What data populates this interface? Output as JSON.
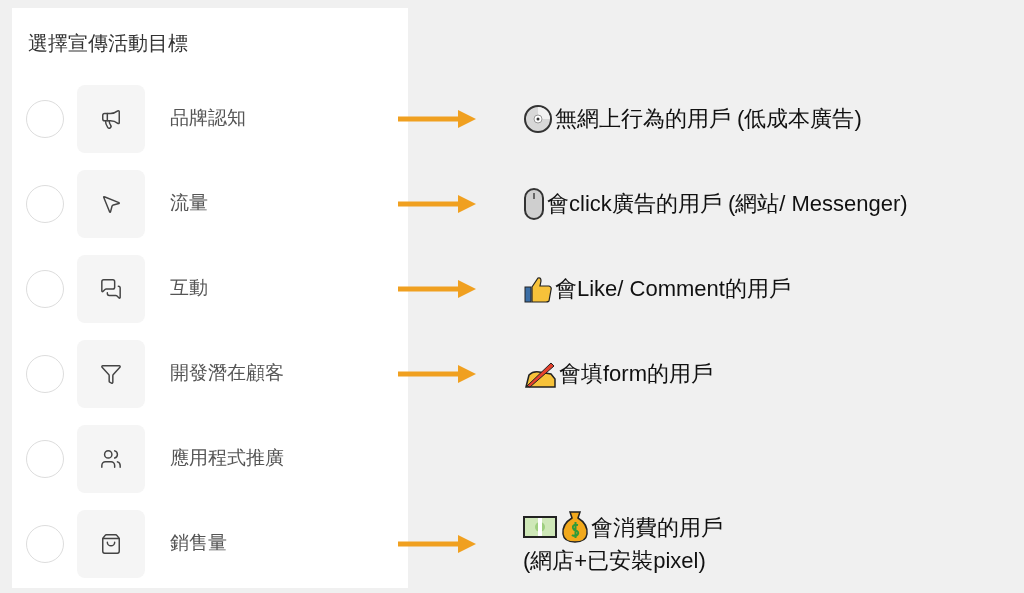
{
  "title": "選擇宣傳活動目標",
  "objectives": [
    {
      "label": "品牌認知",
      "selected": false,
      "annotation": [
        "無網上行為的用戶 (低成本廣告)"
      ]
    },
    {
      "label": "流量",
      "selected": false,
      "annotation": [
        "會click廣告的用戶 (網站/ Messenger)"
      ]
    },
    {
      "label": "互動",
      "selected": false,
      "annotation": [
        "會Like/ Comment的用戶"
      ]
    },
    {
      "label": "開發潛在顧客",
      "selected": false,
      "annotation": [
        "會填form的用戶"
      ]
    },
    {
      "label": "應用程式推廣",
      "selected": false
    },
    {
      "label": "銷售量",
      "selected": false,
      "annotation": [
        "會消費的用戶",
        "(網店+已安裝pixel)"
      ]
    }
  ]
}
